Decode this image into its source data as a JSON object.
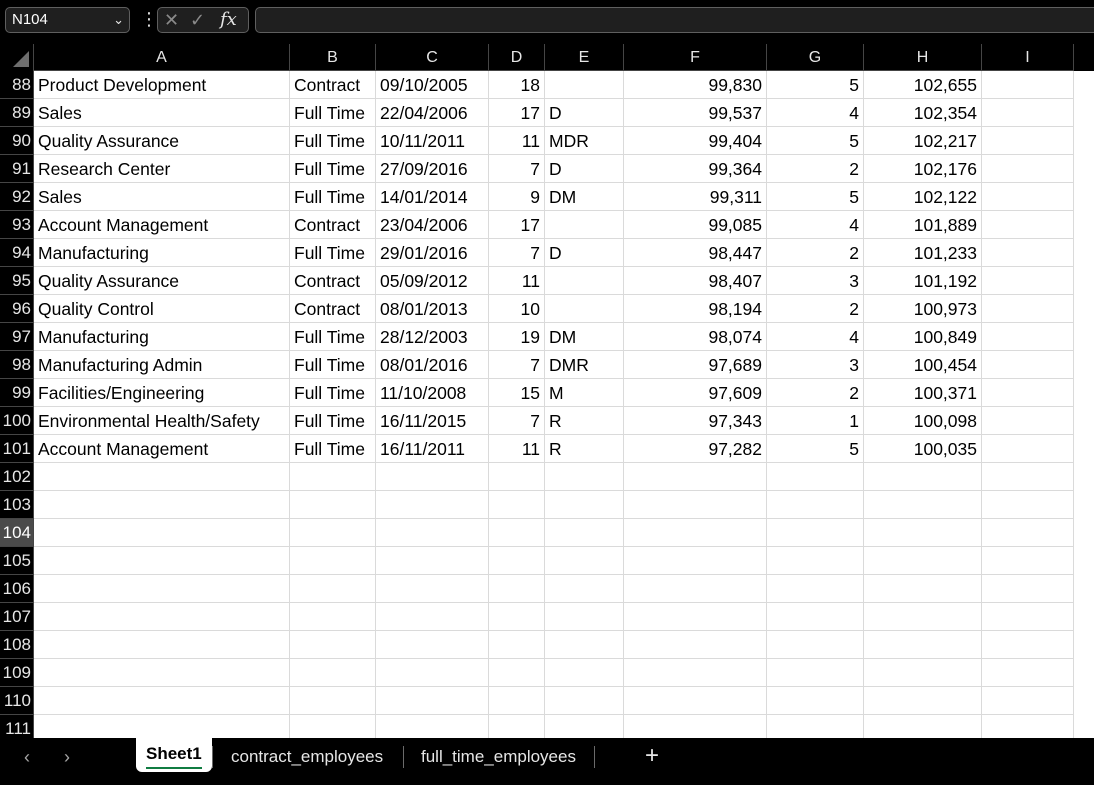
{
  "formula_bar": {
    "name_box": "N104",
    "formula": "",
    "icons": [
      "chevron-down-icon",
      "more-options-icon",
      "cancel-icon",
      "enter-icon",
      "function-icon"
    ],
    "fx_label": "fx"
  },
  "columns": [
    {
      "label": "A",
      "width": 256
    },
    {
      "label": "B",
      "width": 86
    },
    {
      "label": "C",
      "width": 113
    },
    {
      "label": "D",
      "width": 56
    },
    {
      "label": "E",
      "width": 79
    },
    {
      "label": "F",
      "width": 143
    },
    {
      "label": "G",
      "width": 97
    },
    {
      "label": "H",
      "width": 118
    },
    {
      "label": "I",
      "width": 92
    }
  ],
  "active_row": "104",
  "rows": [
    {
      "n": "88",
      "cells": [
        "Product Development",
        "Contract",
        "09/10/2005",
        "18",
        "",
        "99,830",
        "5",
        "102,655",
        ""
      ]
    },
    {
      "n": "89",
      "cells": [
        "Sales",
        "Full Time",
        "22/04/2006",
        "17",
        "D",
        "99,537",
        "4",
        "102,354",
        ""
      ]
    },
    {
      "n": "90",
      "cells": [
        "Quality Assurance",
        "Full Time",
        "10/11/2011",
        "11",
        "MDR",
        "99,404",
        "5",
        "102,217",
        ""
      ]
    },
    {
      "n": "91",
      "cells": [
        "Research Center",
        "Full Time",
        "27/09/2016",
        "7",
        "D",
        "99,364",
        "2",
        "102,176",
        ""
      ]
    },
    {
      "n": "92",
      "cells": [
        "Sales",
        "Full Time",
        "14/01/2014",
        "9",
        "DM",
        "99,311",
        "5",
        "102,122",
        ""
      ]
    },
    {
      "n": "93",
      "cells": [
        "Account Management",
        "Contract",
        "23/04/2006",
        "17",
        "",
        "99,085",
        "4",
        "101,889",
        ""
      ]
    },
    {
      "n": "94",
      "cells": [
        "Manufacturing",
        "Full Time",
        "29/01/2016",
        "7",
        "D",
        "98,447",
        "2",
        "101,233",
        ""
      ]
    },
    {
      "n": "95",
      "cells": [
        "Quality Assurance",
        "Contract",
        "05/09/2012",
        "11",
        "",
        "98,407",
        "3",
        "101,192",
        ""
      ]
    },
    {
      "n": "96",
      "cells": [
        "Quality Control",
        "Contract",
        "08/01/2013",
        "10",
        "",
        "98,194",
        "2",
        "100,973",
        ""
      ]
    },
    {
      "n": "97",
      "cells": [
        "Manufacturing",
        "Full Time",
        "28/12/2003",
        "19",
        "DM",
        "98,074",
        "4",
        "100,849",
        ""
      ]
    },
    {
      "n": "98",
      "cells": [
        "Manufacturing Admin",
        "Full Time",
        "08/01/2016",
        "7",
        "DMR",
        "97,689",
        "3",
        "100,454",
        ""
      ]
    },
    {
      "n": "99",
      "cells": [
        "Facilities/Engineering",
        "Full Time",
        "11/10/2008",
        "15",
        "M",
        "97,609",
        "2",
        "100,371",
        ""
      ]
    },
    {
      "n": "100",
      "cells": [
        "Environmental Health/Safety",
        "Full Time",
        "16/11/2015",
        "7",
        "R",
        "97,343",
        "1",
        "100,098",
        ""
      ]
    },
    {
      "n": "101",
      "cells": [
        "Account Management",
        "Full Time",
        "16/11/2011",
        "11",
        "R",
        "97,282",
        "5",
        "100,035",
        ""
      ]
    },
    {
      "n": "102",
      "cells": [
        "",
        "",
        "",
        "",
        "",
        "",
        "",
        "",
        ""
      ]
    },
    {
      "n": "103",
      "cells": [
        "",
        "",
        "",
        "",
        "",
        "",
        "",
        "",
        ""
      ]
    },
    {
      "n": "104",
      "cells": [
        "",
        "",
        "",
        "",
        "",
        "",
        "",
        "",
        ""
      ]
    },
    {
      "n": "105",
      "cells": [
        "",
        "",
        "",
        "",
        "",
        "",
        "",
        "",
        ""
      ]
    },
    {
      "n": "106",
      "cells": [
        "",
        "",
        "",
        "",
        "",
        "",
        "",
        "",
        ""
      ]
    },
    {
      "n": "107",
      "cells": [
        "",
        "",
        "",
        "",
        "",
        "",
        "",
        "",
        ""
      ]
    },
    {
      "n": "108",
      "cells": [
        "",
        "",
        "",
        "",
        "",
        "",
        "",
        "",
        ""
      ]
    },
    {
      "n": "109",
      "cells": [
        "",
        "",
        "",
        "",
        "",
        "",
        "",
        "",
        ""
      ]
    },
    {
      "n": "110",
      "cells": [
        "",
        "",
        "",
        "",
        "",
        "",
        "",
        "",
        ""
      ]
    },
    {
      "n": "111",
      "cells": [
        "",
        "",
        "",
        "",
        "",
        "",
        "",
        "",
        ""
      ]
    }
  ],
  "numeric_columns": [
    3,
    5,
    6,
    7
  ],
  "sheet_tabs": {
    "prev_icon": "‹",
    "next_icon": "›",
    "tabs": [
      {
        "label": "Sheet1",
        "active": true
      },
      {
        "label": "contract_employees",
        "active": false
      },
      {
        "label": "full_time_employees",
        "active": false
      }
    ],
    "add_label": "+"
  }
}
